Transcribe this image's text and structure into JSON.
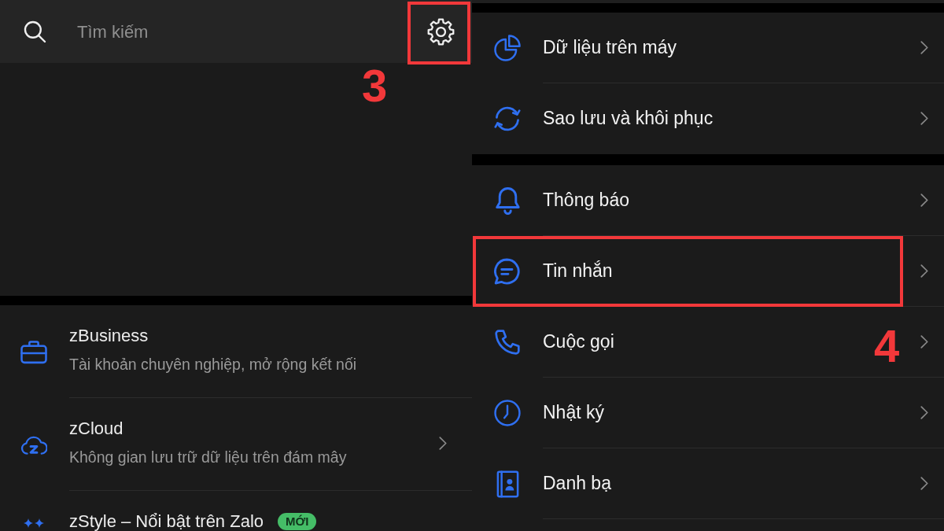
{
  "left_screen": {
    "search": {
      "placeholder": "Tìm kiếm"
    },
    "settings_button": {
      "highlighted": true,
      "step_label": "3"
    },
    "items": [
      {
        "title": "zBusiness",
        "subtitle": "Tài khoản chuyên nghiệp, mở rộng kết nối",
        "chevron": false
      },
      {
        "title": "zCloud",
        "subtitle": "Không gian lưu trữ dữ liệu trên đám mây",
        "chevron": true
      },
      {
        "title": "zStyle – Nổi bật trên Zalo",
        "badge": "MỚI",
        "chevron": false
      }
    ]
  },
  "right_screen": {
    "sections": [
      {
        "items": [
          {
            "label": "Dữ liệu trên máy",
            "highlighted": false
          },
          {
            "label": "Sao lưu và khôi phục",
            "highlighted": false
          }
        ]
      },
      {
        "items": [
          {
            "label": "Thông báo",
            "highlighted": false
          },
          {
            "label": "Tin nhắn",
            "highlighted": true,
            "step_label": "4"
          },
          {
            "label": "Cuộc gọi",
            "highlighted": false
          },
          {
            "label": "Nhật ký",
            "highlighted": false
          },
          {
            "label": "Danh bạ",
            "highlighted": false
          }
        ]
      }
    ]
  }
}
